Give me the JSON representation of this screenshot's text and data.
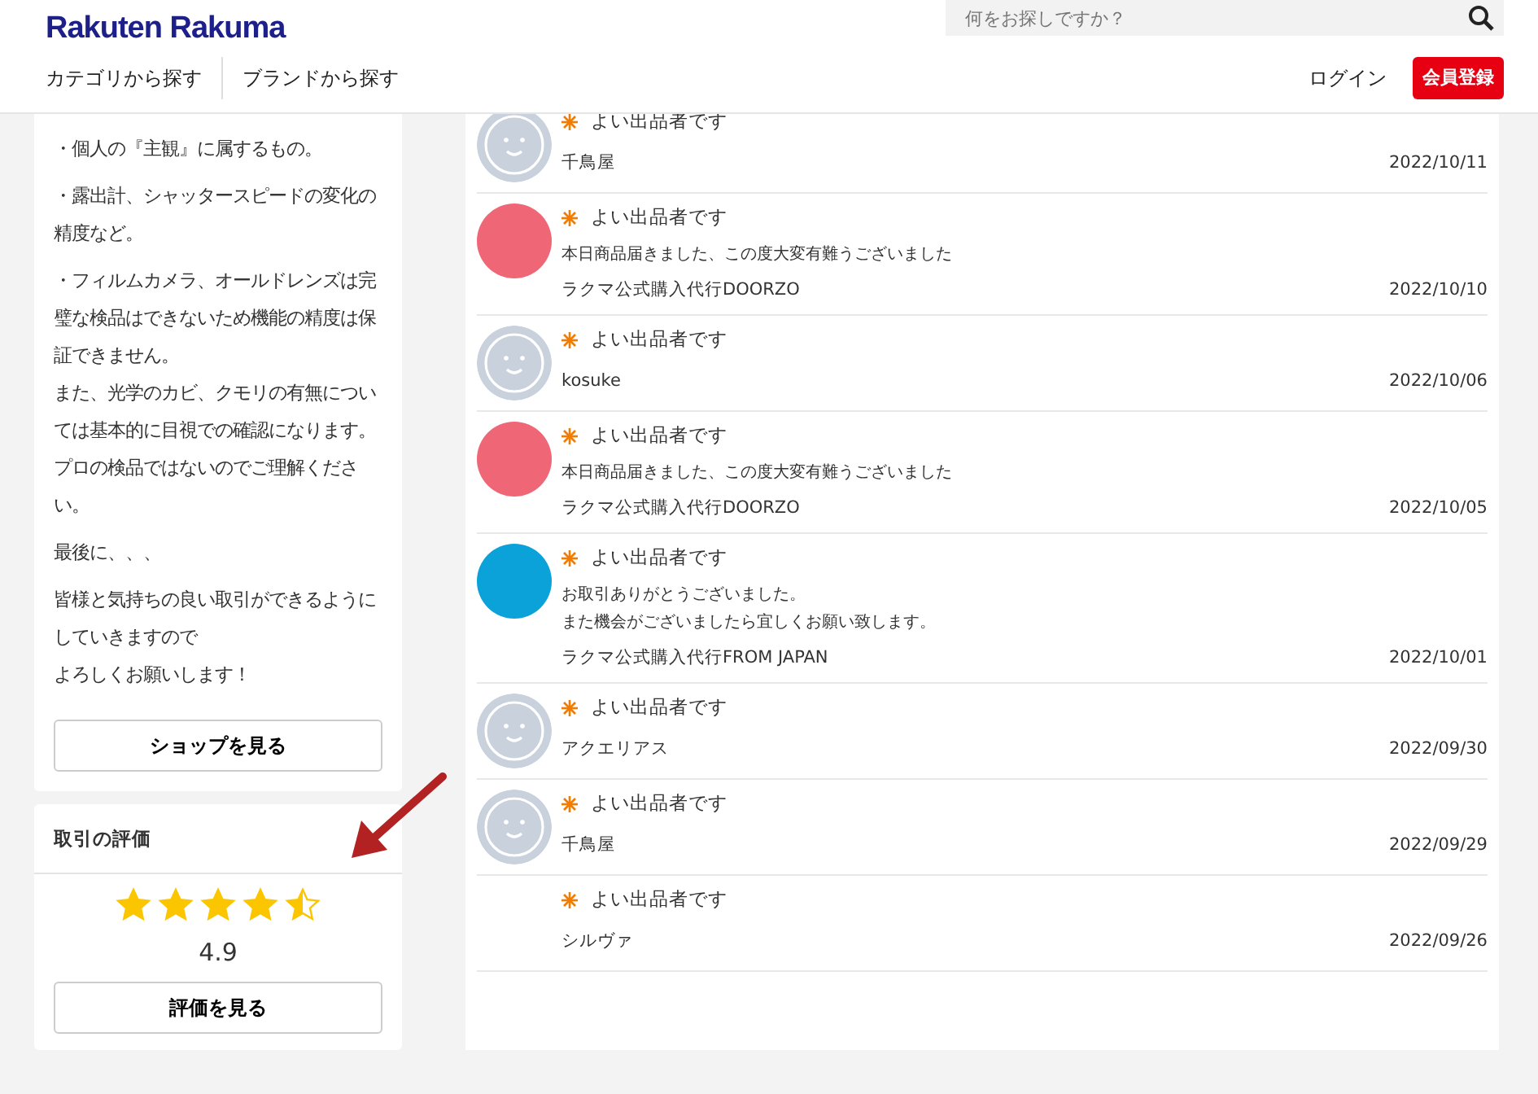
{
  "header": {
    "logo": "Rakuten Rakuma",
    "search": {
      "placeholder": "何をお探しですか？"
    },
    "nav": [
      "カテゴリから探す",
      "ブランドから探す"
    ],
    "login": "ログイン",
    "signup": "会員登録"
  },
  "shop_card": {
    "paragraphs": [
      [
        "・個人の『主観』に属するもの。"
      ],
      [
        "・露出計、シャッタースピードの変化の精度など。"
      ],
      [
        "・フィルムカメラ、オールドレンズは完璧な検品はできないため機能の精度は保証できません。",
        "また、光学のカビ、クモリの有無については基本的に目視での確認になります。",
        "プロの検品ではないのでご理解ください。"
      ],
      [
        "最後に、、、"
      ],
      [
        "皆様と気持ちの良い取引ができるようにしていきますので",
        "よろしくお願いします！"
      ]
    ],
    "button": "ショップを見る"
  },
  "rating_card": {
    "title": "取引の評価",
    "stars": 4.5,
    "score": "4.9",
    "button": "評価を見る"
  },
  "reviews": [
    {
      "kind": "default",
      "rating": "よい出品者です",
      "user": "千鳥屋",
      "date": "2022/10/11"
    },
    {
      "kind": "pink",
      "rating": "よい出品者です",
      "message_lines": [
        "本日商品届きました、この度大変有難うございました"
      ],
      "user": "ラクマ公式購入代行DOORZO",
      "date": "2022/10/10"
    },
    {
      "kind": "default",
      "rating": "よい出品者です",
      "user": "kosuke",
      "date": "2022/10/06"
    },
    {
      "kind": "pink",
      "rating": "よい出品者です",
      "message_lines": [
        "本日商品届きました、この度大変有難うございました"
      ],
      "user": "ラクマ公式購入代行DOORZO",
      "date": "2022/10/05"
    },
    {
      "kind": "blue",
      "rating": "よい出品者です",
      "message_lines": [
        "お取引ありがとうございました。",
        "また機会がございましたら宜しくお願い致します。"
      ],
      "user": "ラクマ公式購入代行FROM JAPAN",
      "date": "2022/10/01"
    },
    {
      "kind": "default",
      "rating": "よい出品者です",
      "user": "アクエリアス",
      "date": "2022/09/30"
    },
    {
      "kind": "default",
      "rating": "よい出品者です",
      "user": "千鳥屋",
      "date": "2022/09/29"
    },
    {
      "kind": "blank",
      "rating": "よい出品者です",
      "user": "シルヴァ",
      "date": "2022/09/26"
    }
  ]
}
